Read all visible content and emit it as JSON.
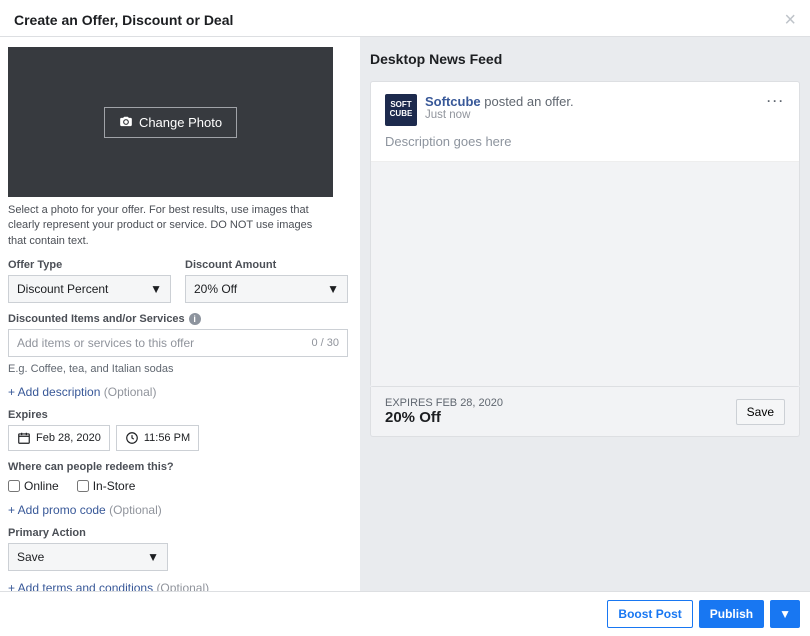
{
  "header": {
    "title": "Create an Offer, Discount or Deal"
  },
  "photo": {
    "change_label": "Change Photo",
    "hint": "Select a photo for your offer. For best results, use images that clearly represent your product or service. DO NOT use images that contain text."
  },
  "offer_type": {
    "label": "Offer Type",
    "value": "Discount Percent"
  },
  "discount_amount": {
    "label": "Discount Amount",
    "value": "20% Off"
  },
  "items": {
    "label": "Discounted Items and/or Services",
    "placeholder": "Add items or services to this offer",
    "count": "0 / 30",
    "hint": "E.g. Coffee, tea, and Italian sodas"
  },
  "add_description": {
    "link": "+ Add description",
    "optional": "(Optional)"
  },
  "expires": {
    "label": "Expires",
    "date": "Feb 28, 2020",
    "time": "11:56 PM"
  },
  "redeem": {
    "label": "Where can people redeem this?",
    "online": "Online",
    "instore": "In-Store"
  },
  "promo": {
    "link": "+ Add promo code",
    "optional": "(Optional)"
  },
  "primary_action": {
    "label": "Primary Action",
    "value": "Save"
  },
  "terms": {
    "link": "+ Add terms and conditions",
    "optional": "(Optional)"
  },
  "preview": {
    "title": "Desktop News Feed",
    "page_name": "Softcube",
    "avatar_text": "SOFT CUBE",
    "posted": " posted an offer.",
    "time": "Just now",
    "description": "Description goes here",
    "expires_label": "EXPIRES FEB 28, 2020",
    "off": "20% Off",
    "save": "Save"
  },
  "footer": {
    "boost": "Boost Post",
    "publish": "Publish"
  }
}
